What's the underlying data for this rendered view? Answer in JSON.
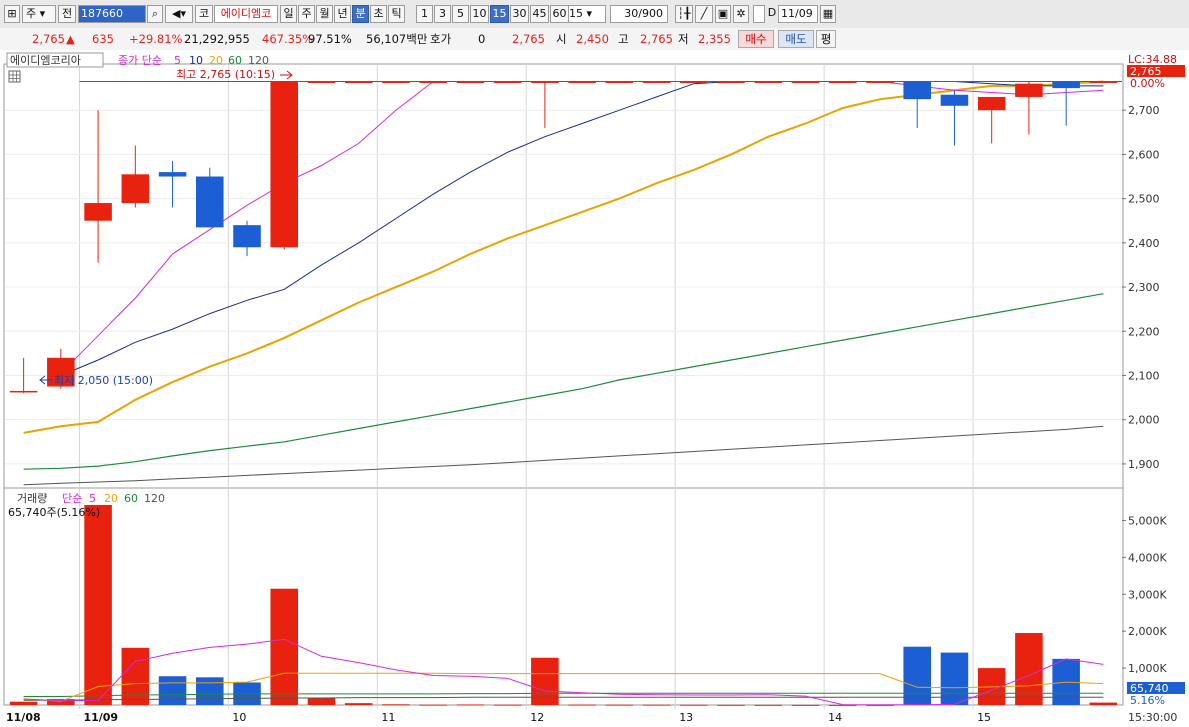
{
  "toolbar": {
    "type_label": "주",
    "prev_label": "전",
    "code": "187660",
    "market_label": "코",
    "stock_name": "에이디엠코",
    "periods": [
      "일",
      "주",
      "월",
      "년",
      "분",
      "초",
      "틱"
    ],
    "selected_period": "분",
    "intervals": [
      "1",
      "3",
      "5",
      "10",
      "15",
      "30",
      "45",
      "60"
    ],
    "selected_interval": "15",
    "interval_value": "15",
    "count_value": "30",
    "count_max": "/900",
    "d_label": "D",
    "date_value": "11/09"
  },
  "info": {
    "price": "2,765",
    "change": "635",
    "change_pct": "+29.81%",
    "volume": "21,292,955",
    "volume_pct": "467.35%",
    "strength": "97.51%",
    "amount": "56,107백만",
    "hoga_label": "호가",
    "hoga_value": "0",
    "hoga_price": "2,765",
    "open_label": "시",
    "open_value": "2,450",
    "high_label": "고",
    "high_value": "2,765",
    "low_label": "저",
    "low_value": "2,355",
    "buy_label": "매수",
    "sell_label": "매도",
    "flat_label": "평"
  },
  "chart": {
    "stock_label": "에이디엠코리아",
    "ma_prefix": "종가 단순",
    "ma_periods": [
      "5",
      "10",
      "20",
      "60",
      "120"
    ],
    "high_annotation": "최고 2,765 (10:15)",
    "low_annotation": "최저 2,050 (15:00)",
    "lc_label": "LC:34.88",
    "current_price_tag": "2,765",
    "current_change_tag": "0.00%",
    "price_ticks": [
      "2,700",
      "2,600",
      "2,500",
      "2,400",
      "2,300",
      "2,200",
      "2,100",
      "2,000",
      "1,900"
    ],
    "volume_label": "거래량",
    "vol_ma_prefix": "단순",
    "vol_ma_periods": [
      "5",
      "20",
      "60",
      "120"
    ],
    "volume_summary": "65,740주(5.16%)",
    "volume_ticks": [
      "5,000K",
      "4,000K",
      "3,000K",
      "2,000K",
      "1,000K"
    ],
    "volume_tag": "65,740",
    "volume_pct_tag": "5.16%",
    "date_labels": [
      "11/08",
      "11/09",
      "10",
      "11",
      "12",
      "13",
      "14",
      "15"
    ],
    "time_label": "15:30:00",
    "colors": {
      "up": "#e8220e",
      "down": "#1c5fd4",
      "ma5": "#d62bd0",
      "ma10": "#1a2c8f",
      "ma20": "#e8a400",
      "ma60": "#1f8a3c",
      "ma120": "#555555"
    }
  },
  "chart_data": {
    "type": "candlestick",
    "price_range": [
      1850,
      2800
    ],
    "volume_range": [
      0,
      5500000
    ],
    "candles": [
      {
        "o": 2065,
        "h": 2140,
        "l": 2060,
        "c": 2065,
        "v": 90000
      },
      {
        "o": 2075,
        "h": 2160,
        "l": 2070,
        "c": 2140,
        "v": 160000
      },
      {
        "o": 2450,
        "h": 2700,
        "l": 2355,
        "c": 2490,
        "v": 5420000
      },
      {
        "o": 2490,
        "h": 2620,
        "l": 2480,
        "c": 2555,
        "v": 1550000
      },
      {
        "o": 2560,
        "h": 2585,
        "l": 2480,
        "c": 2550,
        "v": 780000
      },
      {
        "o": 2550,
        "h": 2570,
        "l": 2435,
        "c": 2435,
        "v": 750000
      },
      {
        "o": 2440,
        "h": 2450,
        "l": 2370,
        "c": 2390,
        "v": 610000
      },
      {
        "o": 2390,
        "h": 2765,
        "l": 2385,
        "c": 2765,
        "v": 3150000
      },
      {
        "o": 2765,
        "h": 2765,
        "l": 2765,
        "c": 2765,
        "v": 190000
      },
      {
        "o": 2765,
        "h": 2765,
        "l": 2765,
        "c": 2765,
        "v": 50000
      },
      {
        "o": 2765,
        "h": 2765,
        "l": 2765,
        "c": 2765,
        "v": 20000
      },
      {
        "o": 2765,
        "h": 2765,
        "l": 2765,
        "c": 2765,
        "v": 10000
      },
      {
        "o": 2765,
        "h": 2765,
        "l": 2765,
        "c": 2765,
        "v": 15000
      },
      {
        "o": 2765,
        "h": 2765,
        "l": 2765,
        "c": 2765,
        "v": 10000
      },
      {
        "o": 2765,
        "h": 2765,
        "l": 2660,
        "c": 2765,
        "v": 1280000
      },
      {
        "o": 2765,
        "h": 2765,
        "l": 2765,
        "c": 2765,
        "v": 12000
      },
      {
        "o": 2765,
        "h": 2765,
        "l": 2765,
        "c": 2765,
        "v": 10000
      },
      {
        "o": 2765,
        "h": 2765,
        "l": 2765,
        "c": 2765,
        "v": 10000
      },
      {
        "o": 2765,
        "h": 2765,
        "l": 2765,
        "c": 2765,
        "v": 8000
      },
      {
        "o": 2765,
        "h": 2765,
        "l": 2765,
        "c": 2765,
        "v": 5000
      },
      {
        "o": 2765,
        "h": 2765,
        "l": 2765,
        "c": 2765,
        "v": 5000
      },
      {
        "o": 2765,
        "h": 2765,
        "l": 2765,
        "c": 2765,
        "v": 4000
      },
      {
        "o": 2765,
        "h": 2765,
        "l": 2765,
        "c": 2765,
        "v": 3000
      },
      {
        "o": 2765,
        "h": 2765,
        "l": 2765,
        "c": 2765,
        "v": 3000
      },
      {
        "o": 2765,
        "h": 2765,
        "l": 2660,
        "c": 2725,
        "v": 1580000
      },
      {
        "o": 2735,
        "h": 2745,
        "l": 2620,
        "c": 2710,
        "v": 1420000
      },
      {
        "o": 2700,
        "h": 2730,
        "l": 2625,
        "c": 2730,
        "v": 1000000
      },
      {
        "o": 2730,
        "h": 2765,
        "l": 2645,
        "c": 2760,
        "v": 1950000
      },
      {
        "o": 2765,
        "h": 2765,
        "l": 2665,
        "c": 2750,
        "v": 1250000
      },
      {
        "o": 2765,
        "h": 2765,
        "l": 2765,
        "c": 2765,
        "v": 65740
      }
    ],
    "ma": {
      "ma5": [
        null,
        2105,
        2190,
        2275,
        2375,
        2430,
        2485,
        2535,
        2575,
        2625,
        2700,
        2765,
        2765,
        2765,
        2765,
        2765,
        2765,
        2765,
        2765,
        2765,
        2765,
        2765,
        2765,
        2765,
        2755,
        2745,
        2740,
        2735,
        2740,
        2745
      ],
      "ma10": [
        null,
        2100,
        2135,
        2175,
        2205,
        2240,
        2270,
        2295,
        2350,
        2400,
        2455,
        2510,
        2560,
        2605,
        2640,
        2670,
        2700,
        2730,
        2760,
        2765,
        2765,
        2765,
        2765,
        2765,
        2765,
        2765,
        2760,
        2755,
        2755,
        2755
      ],
      "ma20": [
        1970,
        1985,
        1995,
        2045,
        2085,
        2120,
        2150,
        2185,
        2225,
        2265,
        2300,
        2335,
        2375,
        2410,
        2440,
        2470,
        2500,
        2535,
        2565,
        2600,
        2640,
        2670,
        2705,
        2725,
        2735,
        2745,
        2755,
        2755,
        2760,
        2765
      ],
      "ma60": [
        1888,
        1890,
        1895,
        1905,
        1918,
        1930,
        1940,
        1950,
        1965,
        1980,
        1995,
        2010,
        2025,
        2040,
        2055,
        2070,
        2090,
        2105,
        2120,
        2135,
        2150,
        2165,
        2180,
        2195,
        2210,
        2225,
        2240,
        2255,
        2270,
        2285
      ],
      "ma120": [
        1853,
        1856,
        1859,
        1862,
        1866,
        1870,
        1874,
        1878,
        1882,
        1886,
        1890,
        1894,
        1898,
        1903,
        1908,
        1913,
        1918,
        1923,
        1928,
        1933,
        1938,
        1943,
        1948,
        1953,
        1958,
        1963,
        1968,
        1973,
        1978,
        1985
      ]
    },
    "vol_ma": {
      "ma5": [
        160000,
        120000,
        120000,
        1180000,
        1400000,
        1560000,
        1650000,
        1780000,
        1320000,
        1150000,
        950000,
        800000,
        780000,
        720000,
        380000,
        330000,
        290000,
        280000,
        270000,
        270000,
        280000,
        240000,
        10000,
        8000,
        9000,
        15000,
        400000,
        800000,
        1250000,
        1100000
      ],
      "ma20": [
        170000,
        100000,
        500000,
        580000,
        600000,
        600000,
        620000,
        860000,
        860000,
        860000,
        860000,
        860000,
        850000,
        850000,
        850000,
        850000,
        850000,
        850000,
        850000,
        850000,
        850000,
        850000,
        850000,
        850000,
        480000,
        470000,
        490000,
        520000,
        620000,
        580000
      ],
      "ma60": [
        230000,
        230000,
        250000,
        270000,
        280000,
        290000,
        300000,
        300000,
        300000,
        300000,
        300000,
        300000,
        310000,
        310000,
        320000,
        320000,
        320000,
        320000,
        320000,
        320000,
        320000,
        320000,
        320000,
        320000,
        320000,
        320000,
        320000,
        320000,
        320000,
        320000
      ],
      "ma120": [
        130000,
        130000,
        140000,
        150000,
        160000,
        170000,
        180000,
        190000,
        190000,
        200000,
        200000,
        200000,
        210000,
        210000,
        210000,
        210000,
        210000,
        210000,
        210000,
        210000,
        210000,
        210000,
        210000,
        210000,
        210000,
        210000,
        210000,
        210000,
        210000,
        210000
      ]
    }
  }
}
